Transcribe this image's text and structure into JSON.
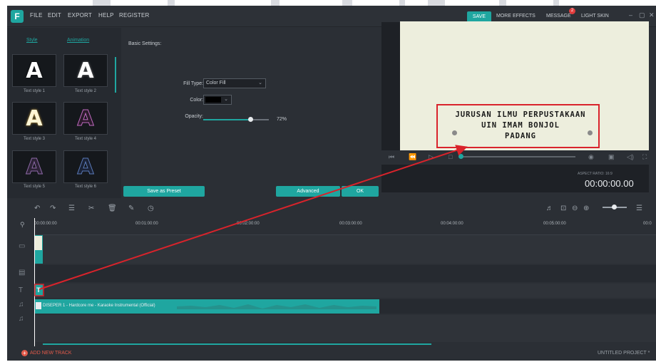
{
  "app": {
    "logo": "F"
  },
  "menu": [
    "FILE",
    "EDIT",
    "EXPORT",
    "HELP",
    "REGISTER"
  ],
  "topbar": {
    "save": "SAVE",
    "more_effects": "MORE EFFECTS",
    "message": "MESSAGE",
    "message_count": "2",
    "light_skin": "LIGHT SKIN",
    "minimize": "–",
    "maximize": "▢",
    "close": "✕"
  },
  "style_panel": {
    "tabs": [
      "Style",
      "Animation"
    ],
    "tiles": [
      {
        "label": "Text style 1",
        "glyph": "A",
        "color": "#ffffff"
      },
      {
        "label": "Text style 2",
        "glyph": "A",
        "color": "#ffffff"
      },
      {
        "label": "Text style 3",
        "glyph": "A",
        "color": "#fff6d5"
      },
      {
        "label": "Text style 4",
        "glyph": "A",
        "color": "#7a3e7a"
      },
      {
        "label": "Text style 5",
        "glyph": "A",
        "color": "#5a3a6e"
      },
      {
        "label": "Text style 6",
        "glyph": "A",
        "color": "#2a3f6e"
      }
    ]
  },
  "settings": {
    "heading": "Basic Settings:",
    "fill_type_label": "Fill Type:",
    "fill_type_value": "Color Fill",
    "color_label": "Color:",
    "color_value": "#000000",
    "opacity_label": "Opacity:",
    "opacity_value": "72%",
    "opacity_fraction": 0.72,
    "save_preset": "Save as Preset",
    "advanced": "Advanced",
    "ok": "OK"
  },
  "preview": {
    "caption_lines": [
      "JURUSAN ILMU PERPUSTAKAAN",
      "UIN IMAM BONJOL",
      "PADANG"
    ],
    "aspect_ratio": "ASPECT RATIO: 16:9",
    "timecode": "00:00:00.00"
  },
  "timeline": {
    "ruler": [
      "00:00:00:00",
      "00:01:00:00",
      "00:02:00:00",
      "00:03:00:00",
      "00:04:00:00",
      "00:05:00:00",
      "00:0"
    ],
    "title_clip": "T",
    "audio_clip_label": "DISEPER 1 - Hardcore me - Karaoke Instrumental (Official)"
  },
  "bottom": {
    "add_track": "ADD NEW TRACK",
    "project": "UNTITLED PROJECT *"
  },
  "colors": {
    "accent": "#1fa6a0",
    "annotation": "#d9232b"
  }
}
